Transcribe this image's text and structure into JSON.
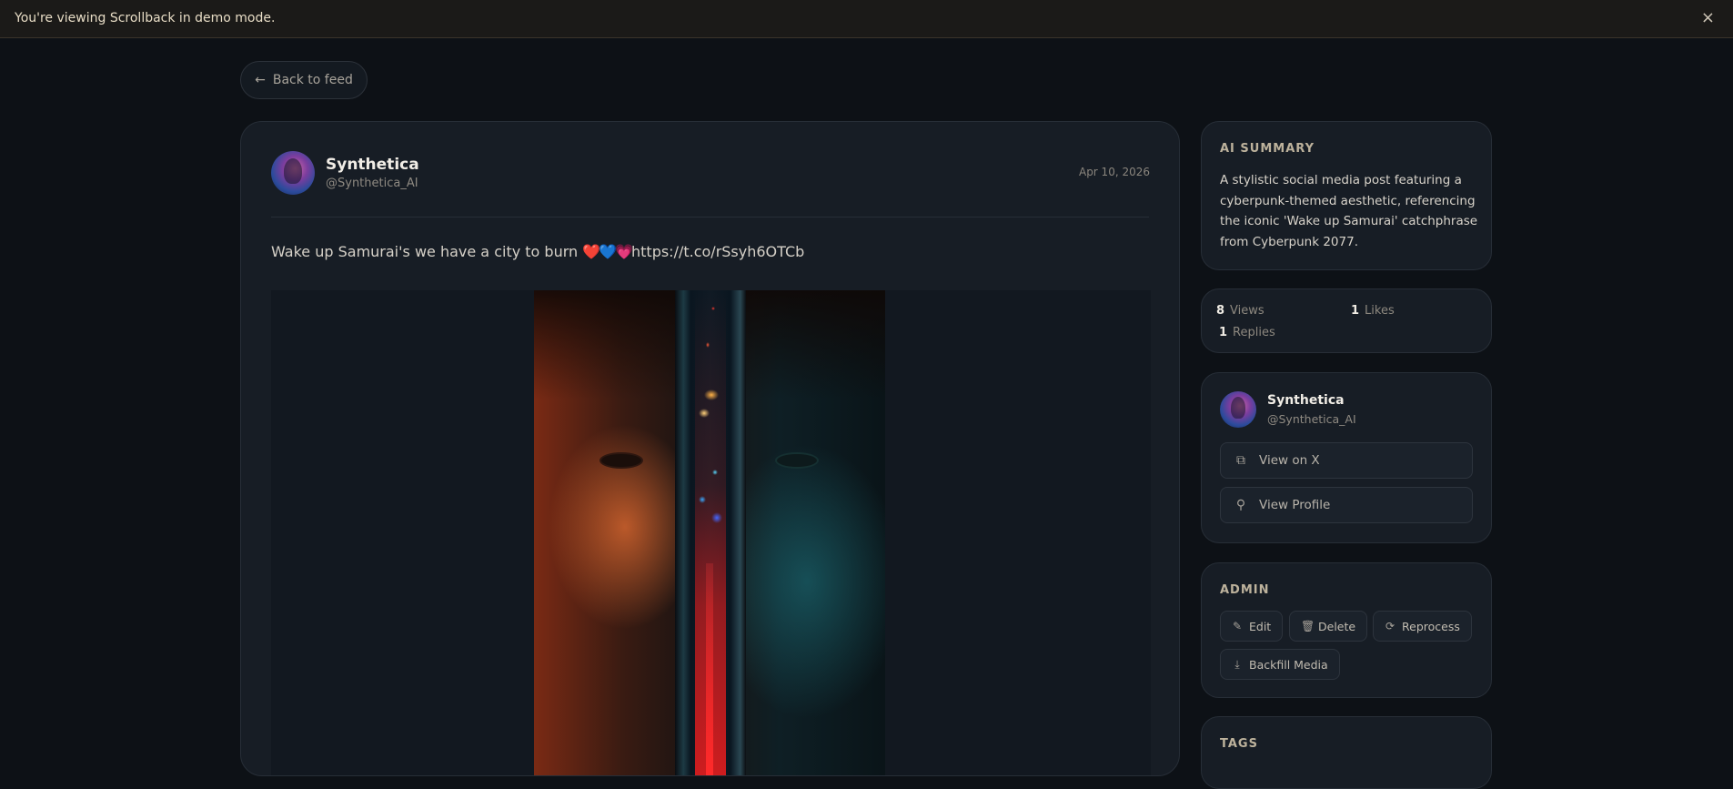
{
  "banner": {
    "text": "You're viewing Scrollback in demo mode.",
    "close_icon": "×"
  },
  "nav": {
    "back_label": "Back to feed",
    "back_icon": "←"
  },
  "post": {
    "author_name": "Synthetica",
    "author_handle": "@Synthetica_AI",
    "date": "Apr 10, 2026",
    "text_prefix": "Wake up Samurai's we have a city to burn ",
    "text_emoji": "❤️💙💗",
    "text_link": "https://t.co/rSsyh6OTCb"
  },
  "sidebar": {
    "summary": {
      "title": "AI SUMMARY",
      "text": "A stylistic social media post featuring a cyberpunk-themed aesthetic, referencing the iconic 'Wake up Samurai' catchphrase from Cyberpunk 2077."
    },
    "stats": {
      "views_count": "8",
      "views_label": "Views",
      "likes_count": "1",
      "likes_label": "Likes",
      "replies_count": "1",
      "replies_label": "Replies"
    },
    "author": {
      "name": "Synthetica",
      "handle": "@Synthetica_AI",
      "view_on_x_label": "View on X",
      "view_profile_label": "View Profile",
      "external_icon": "⧉",
      "user_icon": "⚲"
    },
    "admin": {
      "title": "ADMIN",
      "edit_label": "Edit",
      "delete_label": "Delete",
      "reprocess_label": "Reprocess",
      "backfill_label": "Backfill Media",
      "edit_icon": "✎",
      "delete_icon": "🗑",
      "reprocess_icon": "⟳",
      "backfill_icon": "⤓"
    },
    "tags": {
      "title": "TAGS"
    }
  }
}
